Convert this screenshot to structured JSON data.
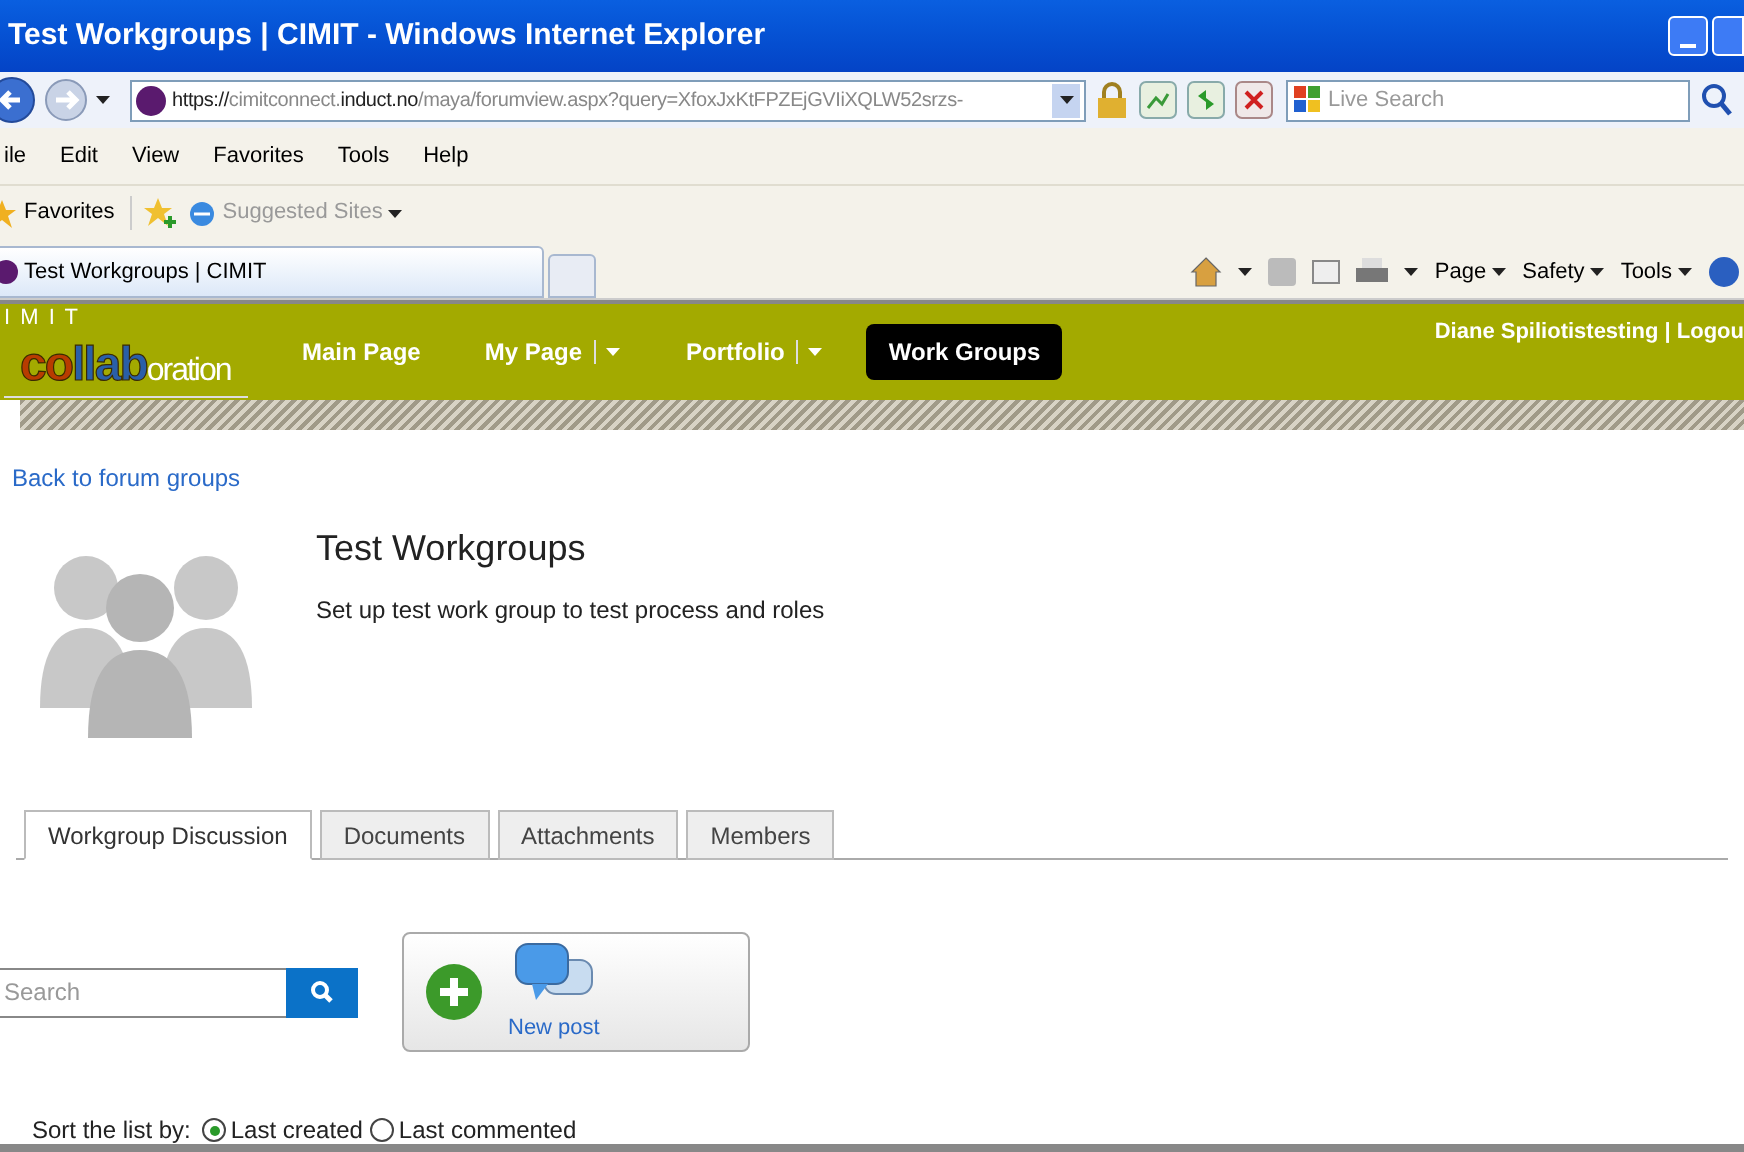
{
  "window": {
    "title": "Test Workgroups | CIMIT - Windows Internet Explorer"
  },
  "address_bar": {
    "url_parts": [
      {
        "text": "https://",
        "kind": "dim"
      },
      {
        "text": "cimitconnect.",
        "kind": "dim"
      },
      {
        "text": "induct.no",
        "kind": "strong"
      },
      {
        "text": "/maya/forumview.aspx?query=XfoxJxKtFPZEjGVIiXQLW52srzs-",
        "kind": "dim"
      }
    ],
    "search_placeholder": "Live Search"
  },
  "menu_bar": [
    "ile",
    "Edit",
    "View",
    "Favorites",
    "Tools",
    "Help"
  ],
  "favorites_bar": {
    "favorites": "Favorites",
    "suggested": "Suggested Sites"
  },
  "browser_tabs": [
    {
      "label": "Test Workgroups | CIMIT",
      "selected": true
    }
  ],
  "command_bar": [
    "Page",
    "Safety",
    "Tools"
  ],
  "site_header": {
    "logo": {
      "top": "I M I T",
      "parts": [
        {
          "text": "co",
          "color": "#b83c00"
        },
        {
          "text": "llab",
          "color": "#2a5fa8"
        },
        {
          "text": "oration",
          "color": "#ffffff"
        }
      ]
    },
    "nav": [
      {
        "label": "Main Page",
        "dropdown": false,
        "selected": false
      },
      {
        "label": "My Page",
        "dropdown": true,
        "selected": false
      },
      {
        "label": "Portfolio",
        "dropdown": true,
        "selected": false
      },
      {
        "label": "Work Groups",
        "dropdown": false,
        "selected": true
      }
    ],
    "user": "Diane Spiliotistesting | Logou"
  },
  "back_link": "Back to forum groups",
  "group": {
    "title": "Test Workgroups",
    "description": "Set up test work group to test process and roles"
  },
  "tabs": [
    {
      "label": "Workgroup Discussion",
      "selected": true
    },
    {
      "label": "Documents",
      "selected": false
    },
    {
      "label": "Attachments",
      "selected": false
    },
    {
      "label": "Members",
      "selected": false
    }
  ],
  "search": {
    "placeholder": "Search"
  },
  "new_post": {
    "label": "New post"
  },
  "sort": {
    "label": "Sort the list by:",
    "options": [
      {
        "label": "Last created",
        "selected": true
      },
      {
        "label": "Last commented",
        "selected": false
      }
    ]
  }
}
